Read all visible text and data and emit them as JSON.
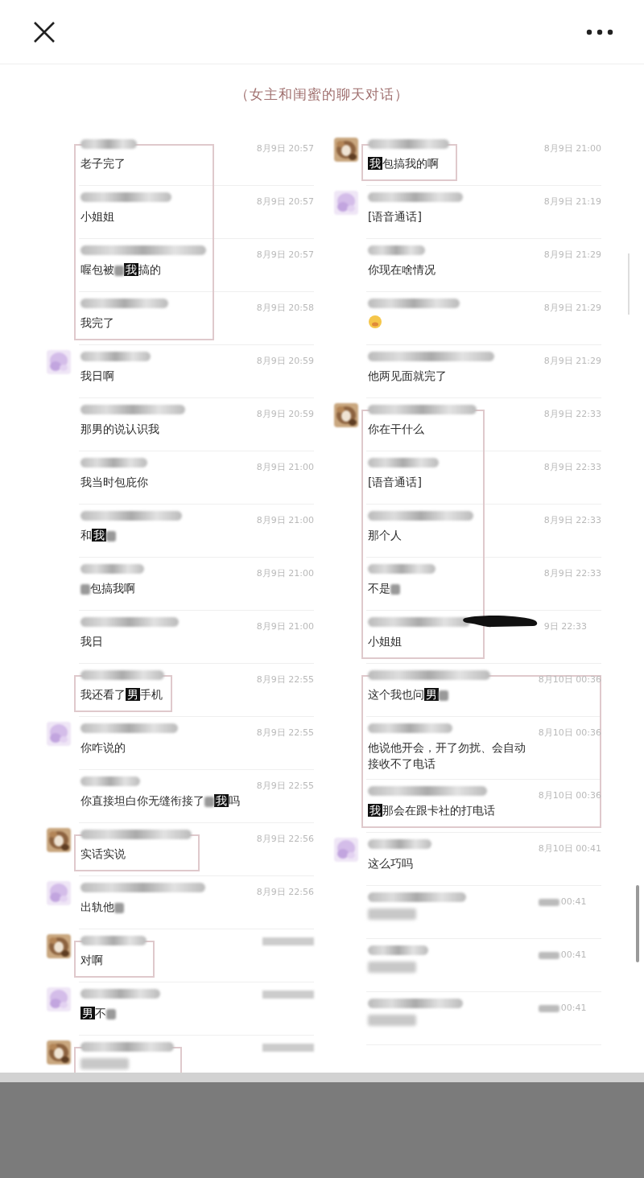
{
  "caption": "（女主和闺蜜的聊天对话）",
  "columns": [
    {
      "blocks": [
        {
          "kind": "framed",
          "messages": [
            {
              "kind": "text",
              "time": "8月9日 20:57",
              "parts": [
                {
                  "kind": "plain",
                  "text": "老子完了"
                }
              ]
            },
            {
              "kind": "text",
              "time": "8月9日 20:57",
              "parts": [
                {
                  "kind": "plain",
                  "text": "小姐姐"
                }
              ]
            },
            {
              "kind": "text",
              "time": "8月9日 20:57",
              "parts": [
                {
                  "kind": "plain",
                  "text": "喔包被"
                },
                {
                  "kind": "smudge"
                },
                {
                  "kind": "mask",
                  "text": "我"
                },
                {
                  "kind": "plain",
                  "text": "搞的"
                }
              ]
            },
            {
              "kind": "text",
              "time": "8月9日 20:58",
              "parts": [
                {
                  "kind": "plain",
                  "text": "我完了"
                }
              ]
            }
          ]
        },
        {
          "kind": "plain",
          "messages": [
            {
              "kind": "text",
              "avatar": {
                "kind": "purple"
              },
              "time": "8月9日 20:59",
              "parts": [
                {
                  "kind": "plain",
                  "text": "我日啊"
                }
              ]
            },
            {
              "kind": "text",
              "time": "8月9日 20:59",
              "parts": [
                {
                  "kind": "plain",
                  "text": "那男的说认识我"
                }
              ]
            },
            {
              "kind": "text",
              "time": "8月9日 21:00",
              "parts": [
                {
                  "kind": "plain",
                  "text": "我当时包庇你"
                }
              ]
            },
            {
              "kind": "text",
              "time": "8月9日 21:00",
              "parts": [
                {
                  "kind": "plain",
                  "text": "和"
                },
                {
                  "kind": "mask",
                  "text": "我"
                },
                {
                  "kind": "smudge"
                }
              ]
            },
            {
              "kind": "text",
              "time": "8月9日 21:00",
              "parts": [
                {
                  "kind": "smudge"
                },
                {
                  "kind": "plain",
                  "text": "包搞我啊"
                }
              ]
            },
            {
              "kind": "text",
              "time": "8月9日 21:00",
              "parts": [
                {
                  "kind": "plain",
                  "text": "我日"
                }
              ]
            }
          ]
        },
        {
          "kind": "framed",
          "messages": [
            {
              "kind": "text",
              "time": "8月9日 22:55",
              "parts": [
                {
                  "kind": "plain",
                  "text": "我还看了"
                },
                {
                  "kind": "mask",
                  "text": "男"
                },
                {
                  "kind": "plain",
                  "text": "手机"
                }
              ]
            }
          ]
        },
        {
          "kind": "plain",
          "messages": [
            {
              "kind": "text",
              "avatar": {
                "kind": "purple"
              },
              "time": "8月9日 22:55",
              "parts": [
                {
                  "kind": "plain",
                  "text": "你咋说的"
                }
              ]
            },
            {
              "kind": "text",
              "time": "8月9日 22:55",
              "parts": [
                {
                  "kind": "plain",
                  "text": "你直接坦白你无缝衔接了"
                },
                {
                  "kind": "smudge"
                },
                {
                  "kind": "mask",
                  "text": "我"
                },
                {
                  "kind": "plain",
                  "text": "吗"
                }
              ]
            }
          ]
        },
        {
          "kind": "framed",
          "messages": [
            {
              "kind": "text",
              "avatar": {
                "kind": "brown"
              },
              "time": "8月9日 22:56",
              "parts": [
                {
                  "kind": "plain",
                  "text": "实话实说"
                }
              ]
            }
          ]
        },
        {
          "kind": "plain",
          "messages": [
            {
              "kind": "text",
              "avatar": {
                "kind": "purple"
              },
              "time": "8月9日 22:56",
              "parts": [
                {
                  "kind": "plain",
                  "text": "出轨他"
                },
                {
                  "kind": "smudge"
                }
              ]
            }
          ]
        },
        {
          "kind": "framed",
          "messages": [
            {
              "kind": "text",
              "avatar": {
                "kind": "brown"
              },
              "parts": [
                {
                  "kind": "plain",
                  "text": "对啊"
                }
              ]
            }
          ]
        },
        {
          "kind": "plain",
          "messages": [
            {
              "kind": "text",
              "avatar": {
                "kind": "purple"
              },
              "parts": [
                {
                  "kind": "mask",
                  "text": "男"
                },
                {
                  "kind": "plain",
                  "text": "不"
                },
                {
                  "kind": "smudge"
                }
              ]
            }
          ]
        },
        {
          "kind": "framed",
          "messages": [
            {
              "kind": "blurred",
              "avatar": {
                "kind": "brown"
              }
            }
          ]
        }
      ]
    },
    {
      "blocks": [
        {
          "kind": "framed",
          "messages": [
            {
              "kind": "text",
              "avatar": {
                "kind": "brown"
              },
              "time": "8月9日 21:00",
              "parts": [
                {
                  "kind": "mask",
                  "text": "我"
                },
                {
                  "kind": "plain",
                  "text": "包搞我的啊"
                }
              ]
            }
          ]
        },
        {
          "kind": "plain",
          "messages": [
            {
              "kind": "text",
              "avatar": {
                "kind": "purple"
              },
              "time": "8月9日 21:19",
              "parts": [
                {
                  "kind": "plain",
                  "text": "[语音通话]"
                }
              ]
            },
            {
              "kind": "text",
              "time": "8月9日 21:29",
              "parts": [
                {
                  "kind": "plain",
                  "text": "你现在啥情况"
                }
              ]
            },
            {
              "kind": "emoji",
              "time": "8月9日 21:29"
            },
            {
              "kind": "text",
              "time": "8月9日 21:29",
              "parts": [
                {
                  "kind": "plain",
                  "text": "他两见面就完了"
                }
              ]
            }
          ]
        },
        {
          "kind": "framed",
          "messages": [
            {
              "kind": "text",
              "avatar": {
                "kind": "brown"
              },
              "time": "8月9日 22:33",
              "parts": [
                {
                  "kind": "plain",
                  "text": "你在干什么"
                }
              ]
            },
            {
              "kind": "text",
              "time": "8月9日 22:33",
              "parts": [
                {
                  "kind": "plain",
                  "text": "[语音通话]"
                }
              ]
            },
            {
              "kind": "text",
              "time": "8月9日 22:33",
              "parts": [
                {
                  "kind": "plain",
                  "text": "那个人"
                }
              ]
            },
            {
              "kind": "text",
              "time": "8月9日 22:33",
              "parts": [
                {
                  "kind": "plain",
                  "text": "不是"
                },
                {
                  "kind": "smudge"
                }
              ]
            },
            {
              "kind": "text",
              "time": "9日 22:33",
              "redacted": true,
              "parts": [
                {
                  "kind": "plain",
                  "text": "小姐姐"
                }
              ]
            }
          ]
        },
        {
          "kind": "framed-wide",
          "messages": [
            {
              "kind": "text",
              "time": "8月10日 00:36",
              "parts": [
                {
                  "kind": "plain",
                  "text": "这个我也问"
                },
                {
                  "kind": "mask",
                  "text": "男"
                },
                {
                  "kind": "smudge"
                }
              ]
            },
            {
              "kind": "text",
              "time": "8月10日 00:36",
              "parts": [
                {
                  "kind": "plain",
                  "text": "他说他开会，开了勿扰、会自动接收不了电话"
                }
              ]
            },
            {
              "kind": "text",
              "time": "8月10日 00:36",
              "parts": [
                {
                  "kind": "mask",
                  "text": "我"
                },
                {
                  "kind": "plain",
                  "text": "那会在跟卡社的打电话"
                }
              ]
            }
          ]
        },
        {
          "kind": "plain",
          "messages": [
            {
              "kind": "text",
              "avatar": {
                "kind": "purple"
              },
              "time": "8月10日 00:41",
              "parts": [
                {
                  "kind": "plain",
                  "text": "这么巧吗"
                }
              ]
            },
            {
              "kind": "blurred",
              "time": "00:41"
            },
            {
              "kind": "blurred",
              "time": "00:41"
            },
            {
              "kind": "blurred",
              "time": "00:41"
            }
          ]
        }
      ]
    }
  ]
}
